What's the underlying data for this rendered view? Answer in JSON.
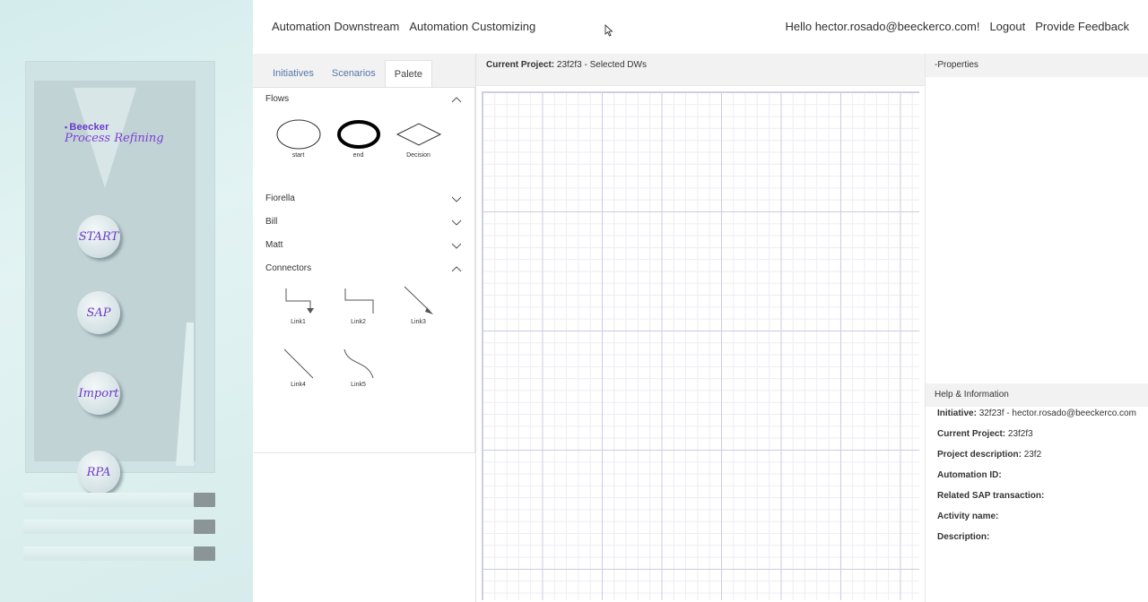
{
  "header": {
    "menu": [
      "Automation Downstream",
      "Automation Customizing"
    ],
    "greeting": "Hello hector.rosado@beeckerco.com!",
    "logout": "Logout",
    "feedback": "Provide Feedback"
  },
  "sidebar": {
    "logo_top": "Beecker",
    "logo_bottom": "Process Refining",
    "nav": [
      "START",
      "SAP",
      "Import",
      "RPA"
    ]
  },
  "palette": {
    "tabs": [
      "Initiatives",
      "Scenarios",
      "Palete"
    ],
    "active_tab": "Palete",
    "sections": {
      "flows": "Flows",
      "fiorella": "Fiorella",
      "bill": "Bill",
      "matt": "Matt",
      "connectors": "Connectors"
    },
    "flow_shapes": [
      "start",
      "end",
      "Decision"
    ],
    "connector_shapes": [
      "Link1",
      "Link2",
      "Link3",
      "Link4",
      "Link5"
    ]
  },
  "canvas": {
    "title_label": "Current Project:",
    "title_value": "23f2f3 - Selected DWs"
  },
  "properties": {
    "title": "-Properties"
  },
  "help": {
    "title": "Help & Information",
    "rows": [
      {
        "label": "Initiative:",
        "value": "32f23f - hector.rosado@beeckerco.com"
      },
      {
        "label": "Current Project:",
        "value": "23f2f3"
      },
      {
        "label": "Project description:",
        "value": "23f2"
      },
      {
        "label": "Automation ID:",
        "value": ""
      },
      {
        "label": "Related SAP transaction:",
        "value": ""
      },
      {
        "label": "Activity name:",
        "value": ""
      },
      {
        "label": "Description:",
        "value": ""
      }
    ]
  }
}
